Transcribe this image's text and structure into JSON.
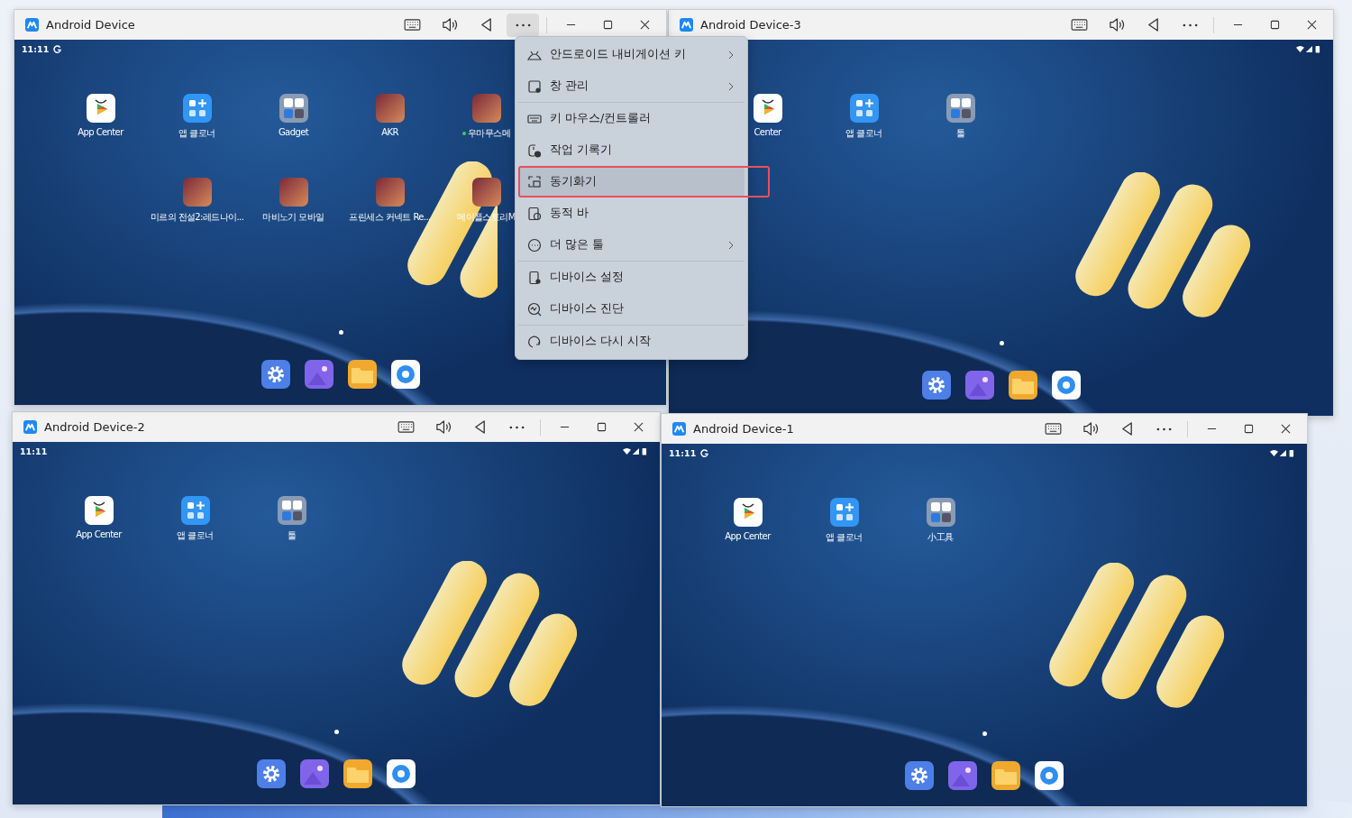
{
  "windows": [
    {
      "title": "Android Device",
      "menu_open": true,
      "time": "11:11",
      "notification_icon": true,
      "app_rows": [
        [
          {
            "label": "App Center",
            "kind": "store",
            "new": false
          },
          {
            "label": "앱 클로너",
            "kind": "cloner",
            "new": false
          },
          {
            "label": "Gadget",
            "kind": "folder",
            "new": false
          },
          {
            "label": "AKR",
            "kind": "game",
            "new": false
          },
          {
            "label": "우마무스메",
            "kind": "game",
            "new": true
          }
        ],
        [
          {
            "label": "미르의 전설2:레드나이...",
            "kind": "game",
            "new": false
          },
          {
            "label": "마비노기 모바일",
            "kind": "game",
            "new": false
          },
          {
            "label": "프린세스 커넥트 Re...",
            "kind": "game",
            "new": false
          },
          {
            "label": "메이플스토리M",
            "kind": "game",
            "new": false
          }
        ]
      ]
    },
    {
      "title": "Android Device-3",
      "menu_open": false,
      "notification_icon": false,
      "app_rows": [
        [
          {
            "label": "Center",
            "kind": "store",
            "new": false
          },
          {
            "label": "앱 클로너",
            "kind": "cloner",
            "new": false
          },
          {
            "label": "툴",
            "kind": "folder",
            "new": false
          }
        ]
      ]
    },
    {
      "title": "Android Device-2",
      "menu_open": false,
      "time": "11:11",
      "notification_icon": false,
      "app_rows": [
        [
          {
            "label": "App Center",
            "kind": "store",
            "new": false
          },
          {
            "label": "앱 클로너",
            "kind": "cloner",
            "new": false
          },
          {
            "label": "툴",
            "kind": "folder",
            "new": false
          }
        ]
      ]
    },
    {
      "title": "Android Device-1",
      "menu_open": false,
      "time": "11:11",
      "notification_icon": true,
      "app_rows": [
        [
          {
            "label": "App Center",
            "kind": "store",
            "new": false
          },
          {
            "label": "앱 클로너",
            "kind": "cloner",
            "new": false
          },
          {
            "label": "小工具",
            "kind": "folder",
            "new": false
          }
        ]
      ]
    }
  ],
  "menu": {
    "items": [
      {
        "label": "안드로이드 내비게이션 키",
        "submenu": true,
        "divider_after": false,
        "selected": false
      },
      {
        "label": "창 관리",
        "submenu": true,
        "divider_after": true,
        "selected": false
      },
      {
        "label": "키 마우스/컨트롤러",
        "submenu": false,
        "divider_after": false,
        "selected": false
      },
      {
        "label": "작업 기록기",
        "submenu": false,
        "divider_after": false,
        "selected": false
      },
      {
        "label": "동기화기",
        "submenu": false,
        "divider_after": false,
        "selected": true
      },
      {
        "label": "동적 바",
        "submenu": false,
        "divider_after": false,
        "selected": false
      },
      {
        "label": "더 많은 툴",
        "submenu": true,
        "divider_after": true,
        "selected": false
      },
      {
        "label": "디바이스 설정",
        "submenu": false,
        "divider_after": false,
        "selected": false
      },
      {
        "label": "디바이스 진단",
        "submenu": false,
        "divider_after": true,
        "selected": false
      },
      {
        "label": "디바이스 다시 시작",
        "submenu": false,
        "divider_after": false,
        "selected": false
      }
    ]
  }
}
